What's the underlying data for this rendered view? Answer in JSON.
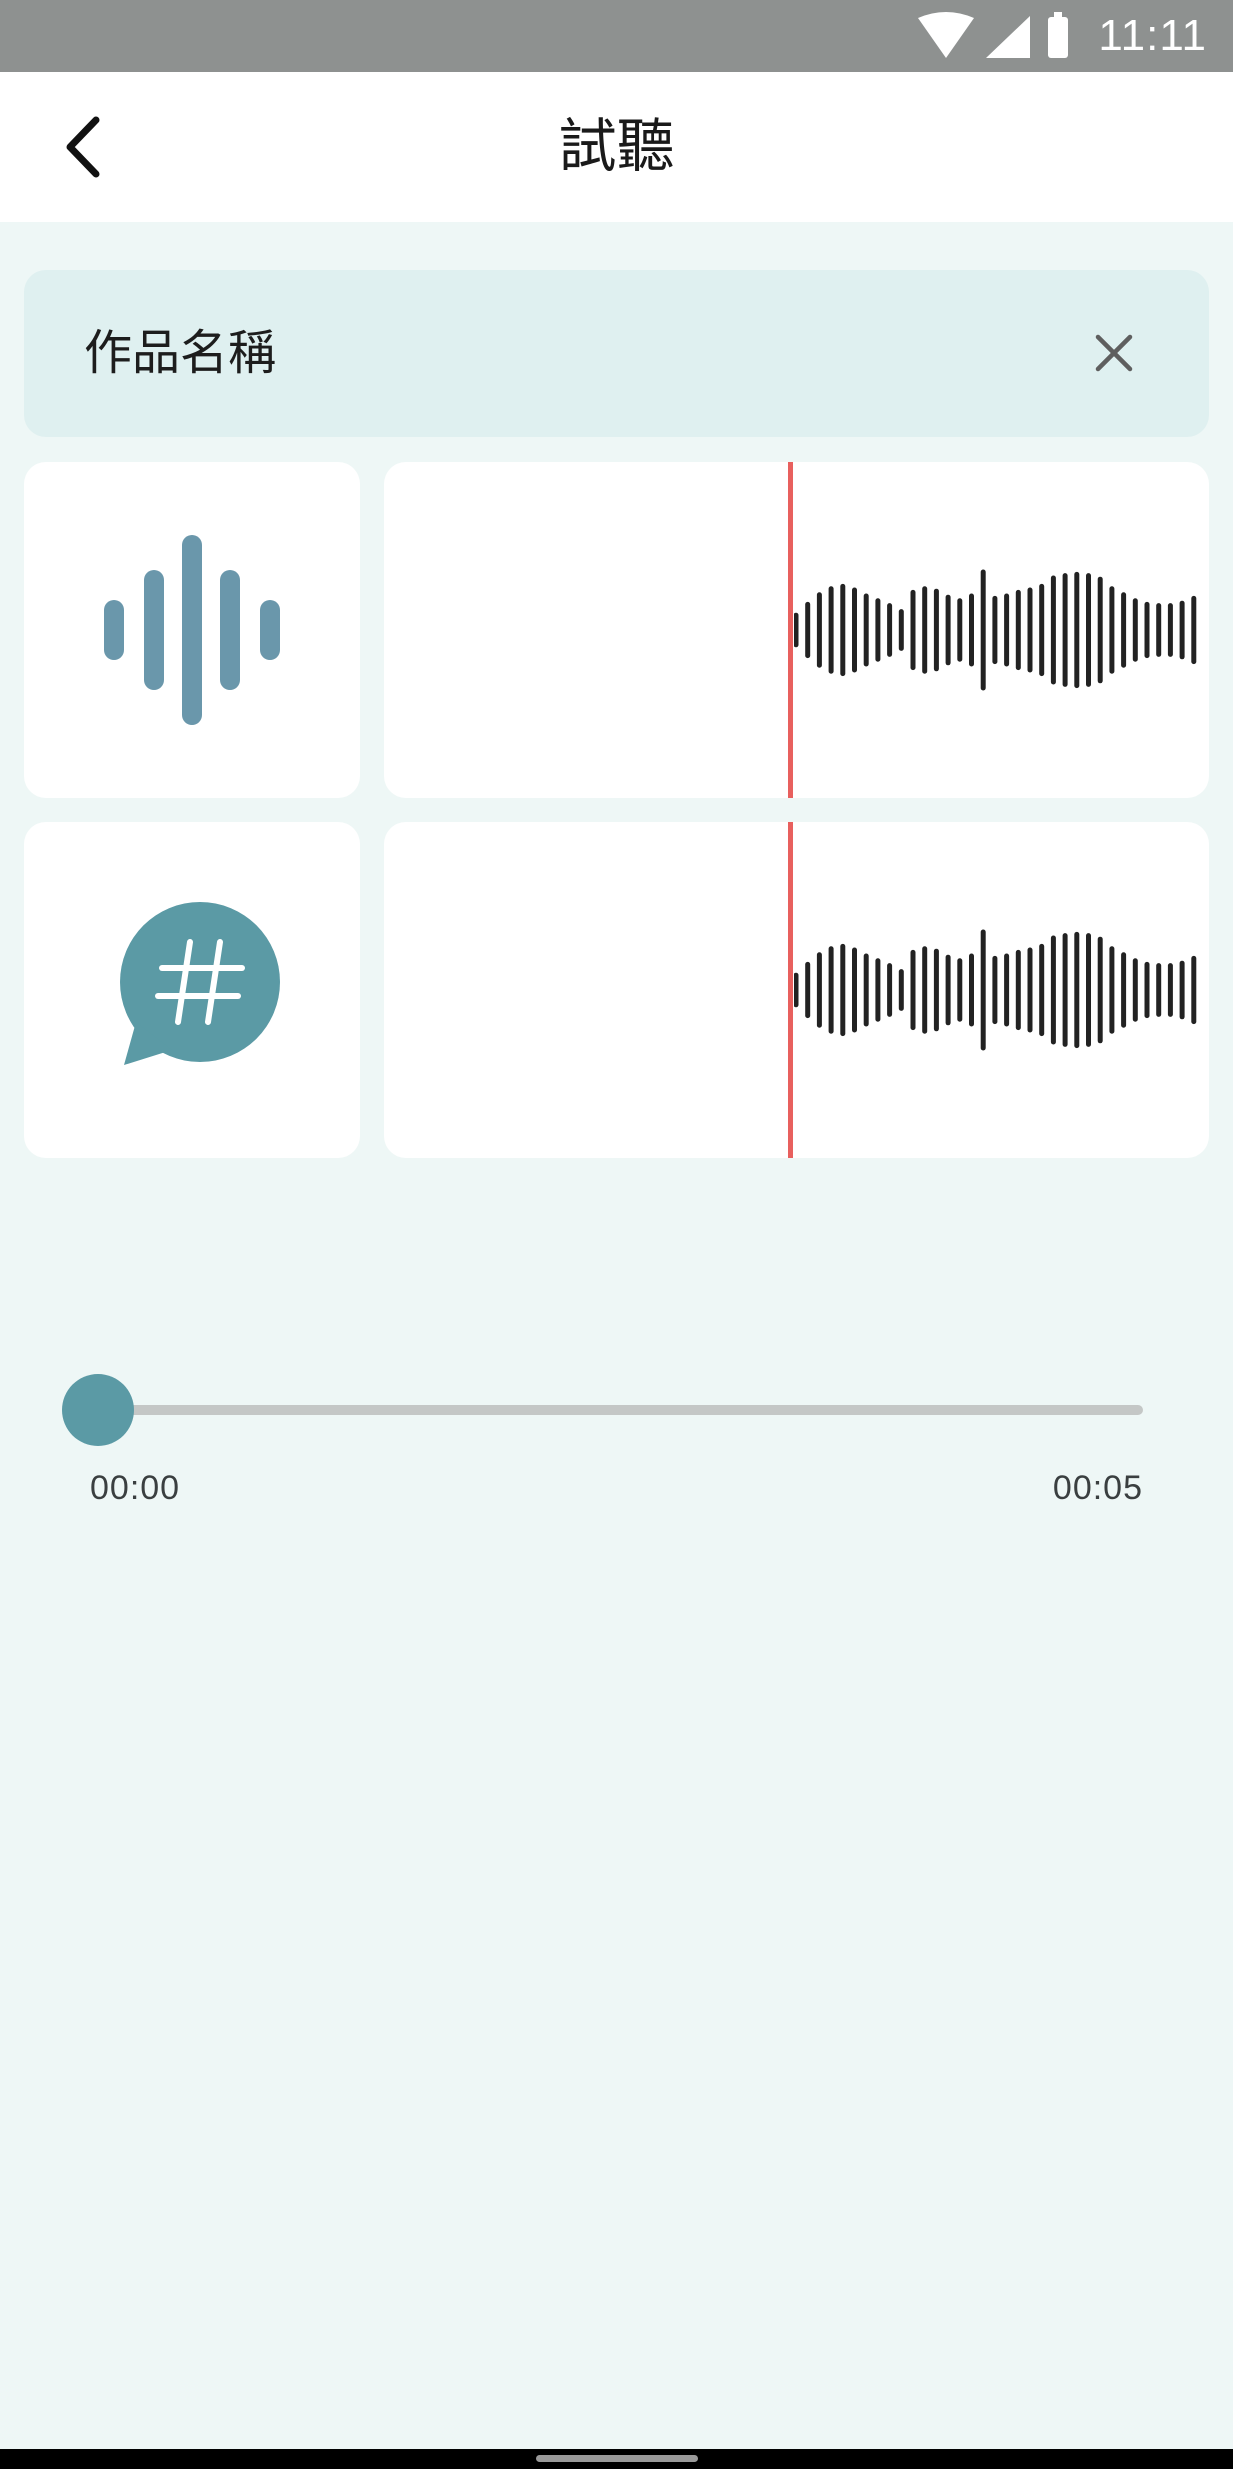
{
  "status_bar": {
    "time": "11:11",
    "icons": [
      "wifi-icon",
      "cellular-signal-icon",
      "battery-icon"
    ]
  },
  "app_bar": {
    "title": "試聽",
    "back_icon": "chevron-left-icon"
  },
  "work": {
    "name_label": "作品名稱",
    "close_icon": "close-icon"
  },
  "tracks": [
    {
      "type": "voice",
      "icon": "voice-waveform-icon",
      "icon_color": "#6a97ab"
    },
    {
      "type": "background",
      "icon": "hashtag-chat-bubble-icon",
      "icon_color": "#5b9aa5"
    }
  ],
  "player": {
    "current_time": "00:00",
    "total_time": "00:05",
    "progress": 0
  },
  "colors": {
    "accent": "#5b9aa5",
    "playhead": "#e8605e",
    "background": "#eef7f6",
    "header_box": "#dff0f0"
  }
}
